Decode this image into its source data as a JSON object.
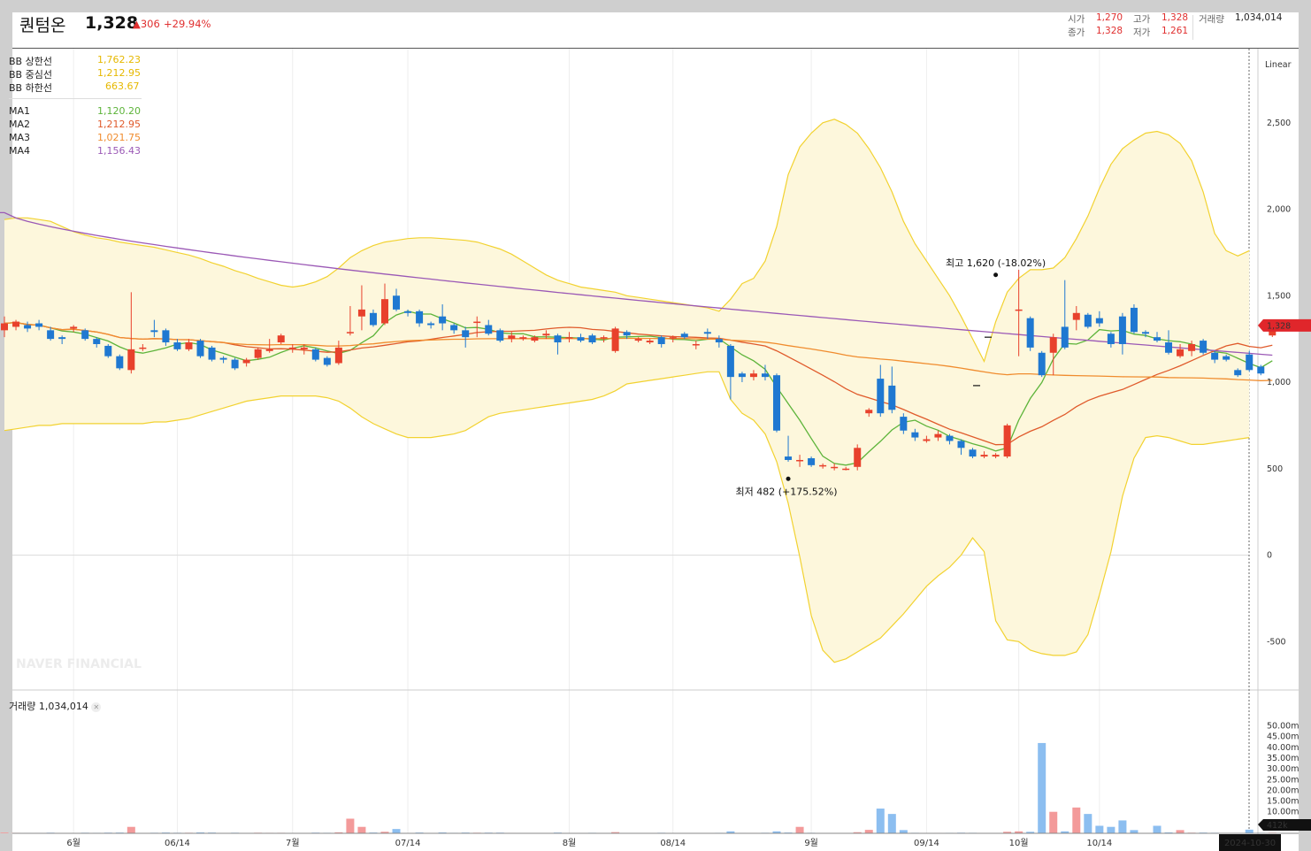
{
  "header": {
    "name": "퀀텀온",
    "price": "1,328",
    "change": "306",
    "change_rate": "+29.94%",
    "open_label": "시가",
    "open": "1,270",
    "high_label": "고가",
    "high": "1,328",
    "close_label": "종가",
    "close": "1,328",
    "low_label": "저가",
    "low": "1,261",
    "volume_label": "거래량",
    "volume": "1,034,014"
  },
  "legend": {
    "bb_upper_label": "BB 상한선",
    "bb_upper": "1,762.23",
    "bb_mid_label": "BB 중심선",
    "bb_mid": "1,212.95",
    "bb_lower_label": "BB 하한선",
    "bb_lower": "663.67",
    "ma1_label": "MA1",
    "ma1": "1,120.20",
    "ma2_label": "MA2",
    "ma2": "1,212.95",
    "ma3_label": "MA3",
    "ma3": "1,021.75",
    "ma4_label": "MA4",
    "ma4": "1,156.43"
  },
  "scale_label": "Linear",
  "annotations": {
    "high": "최고 1,620 (-18.02%)",
    "low": "최저 482 (+175.52%)"
  },
  "current_price_tag": "1,328",
  "volume_legend": "거래량 1,034,014",
  "volume_tag": "412k",
  "date_tag": "2024-10-30",
  "watermark": "NAVER FINANCIAL",
  "colors": {
    "up": "#e8412c",
    "down": "#1f78d1",
    "bb": "#f2d230",
    "bb_fill": "#fdf7dc",
    "ma1": "#5db43a",
    "ma2": "#e05a2b",
    "ma3": "#f08c2e",
    "ma4": "#9b59b6"
  },
  "chart_data": {
    "type": "candlestick",
    "price_axis": {
      "ticks": [
        2500,
        2000,
        1500,
        1000,
        500,
        0,
        -500
      ],
      "ylim": [
        -800,
        2760
      ]
    },
    "volume_axis": {
      "unit": "m",
      "ticks": [
        50,
        45,
        40,
        35,
        30,
        25,
        20,
        15,
        10
      ],
      "ylim": [
        0,
        54
      ]
    },
    "x_ticks": [
      {
        "label": "6월",
        "index": 6
      },
      {
        "label": "06/14",
        "index": 15
      },
      {
        "label": "7월",
        "index": 25
      },
      {
        "label": "07/14",
        "index": 35
      },
      {
        "label": "8월",
        "index": 49
      },
      {
        "label": "08/14",
        "index": 58
      },
      {
        "label": "9월",
        "index": 70
      },
      {
        "label": "09/14",
        "index": 80
      },
      {
        "label": "10월",
        "index": 88
      },
      {
        "label": "10/14",
        "index": 95
      }
    ],
    "ohlc": [
      [
        1300,
        1340,
        1260,
        1380
      ],
      [
        1320,
        1350,
        1300,
        1360
      ],
      [
        1330,
        1310,
        1290,
        1350
      ],
      [
        1340,
        1320,
        1300,
        1360
      ],
      [
        1300,
        1250,
        1240,
        1320
      ],
      [
        1260,
        1250,
        1220,
        1270
      ],
      [
        1310,
        1320,
        1290,
        1330
      ],
      [
        1300,
        1250,
        1240,
        1310
      ],
      [
        1250,
        1220,
        1200,
        1260
      ],
      [
        1210,
        1150,
        1140,
        1220
      ],
      [
        1150,
        1080,
        1070,
        1160
      ],
      [
        1070,
        1190,
        1050,
        1520
      ],
      [
        1200,
        1200,
        1180,
        1220
      ],
      [
        1300,
        1290,
        1260,
        1360
      ],
      [
        1300,
        1230,
        1210,
        1310
      ],
      [
        1230,
        1190,
        1180,
        1250
      ],
      [
        1190,
        1230,
        1180,
        1250
      ],
      [
        1240,
        1150,
        1140,
        1250
      ],
      [
        1200,
        1130,
        1120,
        1210
      ],
      [
        1140,
        1130,
        1110,
        1150
      ],
      [
        1130,
        1080,
        1070,
        1140
      ],
      [
        1110,
        1130,
        1090,
        1140
      ],
      [
        1140,
        1190,
        1130,
        1200
      ],
      [
        1180,
        1190,
        1170,
        1250
      ],
      [
        1230,
        1270,
        1220,
        1280
      ],
      [
        1200,
        1200,
        1170,
        1220
      ],
      [
        1190,
        1200,
        1160,
        1220
      ],
      [
        1190,
        1130,
        1120,
        1200
      ],
      [
        1140,
        1100,
        1090,
        1150
      ],
      [
        1110,
        1200,
        1100,
        1240
      ],
      [
        1290,
        1290,
        1270,
        1440
      ],
      [
        1380,
        1420,
        1300,
        1560
      ],
      [
        1400,
        1330,
        1320,
        1420
      ],
      [
        1340,
        1480,
        1330,
        1570
      ],
      [
        1500,
        1420,
        1410,
        1540
      ],
      [
        1410,
        1400,
        1380,
        1420
      ],
      [
        1410,
        1340,
        1320,
        1420
      ],
      [
        1340,
        1330,
        1310,
        1350
      ],
      [
        1380,
        1340,
        1300,
        1450
      ],
      [
        1330,
        1300,
        1280,
        1340
      ],
      [
        1300,
        1260,
        1200,
        1320
      ],
      [
        1350,
        1350,
        1260,
        1380
      ],
      [
        1330,
        1280,
        1270,
        1360
      ],
      [
        1300,
        1240,
        1230,
        1310
      ],
      [
        1250,
        1270,
        1230,
        1290
      ],
      [
        1250,
        1260,
        1240,
        1270
      ],
      [
        1240,
        1260,
        1230,
        1270
      ],
      [
        1270,
        1280,
        1250,
        1300
      ],
      [
        1270,
        1230,
        1160,
        1280
      ],
      [
        1260,
        1260,
        1230,
        1290
      ],
      [
        1260,
        1240,
        1230,
        1280
      ],
      [
        1270,
        1230,
        1220,
        1280
      ],
      [
        1260,
        1260,
        1230,
        1270
      ],
      [
        1180,
        1310,
        1170,
        1320
      ],
      [
        1290,
        1270,
        1250,
        1300
      ],
      [
        1240,
        1250,
        1230,
        1260
      ],
      [
        1230,
        1240,
        1220,
        1250
      ],
      [
        1260,
        1220,
        1200,
        1270
      ],
      [
        1260,
        1260,
        1230,
        1270
      ],
      [
        1280,
        1260,
        1250,
        1290
      ],
      [
        1220,
        1220,
        1190,
        1240
      ],
      [
        1290,
        1280,
        1250,
        1310
      ],
      [
        1250,
        1230,
        1200,
        1270
      ],
      [
        1210,
        1030,
        900,
        1220
      ],
      [
        1050,
        1030,
        1000,
        1060
      ],
      [
        1030,
        1050,
        1010,
        1070
      ],
      [
        1050,
        1030,
        1010,
        1100
      ],
      [
        1040,
        720,
        710,
        1050
      ],
      [
        570,
        550,
        540,
        690
      ],
      [
        550,
        550,
        510,
        580
      ],
      [
        560,
        520,
        510,
        570
      ],
      [
        520,
        520,
        500,
        530
      ],
      [
        510,
        510,
        490,
        530
      ],
      [
        500,
        500,
        490,
        510
      ],
      [
        510,
        620,
        490,
        640
      ],
      [
        820,
        840,
        800,
        850
      ],
      [
        1020,
        820,
        800,
        1100
      ],
      [
        980,
        840,
        820,
        1090
      ],
      [
        800,
        720,
        700,
        820
      ],
      [
        710,
        680,
        660,
        730
      ],
      [
        660,
        670,
        650,
        690
      ],
      [
        680,
        700,
        660,
        720
      ],
      [
        690,
        660,
        640,
        700
      ],
      [
        660,
        620,
        580,
        670
      ],
      [
        610,
        570,
        560,
        620
      ],
      [
        570,
        580,
        560,
        600
      ],
      [
        570,
        580,
        560,
        590
      ],
      [
        570,
        750,
        560,
        760
      ],
      [
        1420,
        1420,
        1150,
        1650
      ],
      [
        1370,
        1200,
        1180,
        1380
      ],
      [
        1170,
        1040,
        1030,
        1180
      ],
      [
        1170,
        1260,
        1040,
        1280
      ],
      [
        1320,
        1200,
        1190,
        1590
      ],
      [
        1360,
        1400,
        1300,
        1440
      ],
      [
        1390,
        1320,
        1310,
        1400
      ],
      [
        1370,
        1340,
        1320,
        1410
      ],
      [
        1280,
        1220,
        1200,
        1290
      ],
      [
        1380,
        1220,
        1160,
        1400
      ],
      [
        1430,
        1290,
        1280,
        1450
      ],
      [
        1290,
        1280,
        1260,
        1300
      ],
      [
        1260,
        1240,
        1230,
        1290
      ],
      [
        1230,
        1170,
        1160,
        1300
      ],
      [
        1150,
        1190,
        1140,
        1220
      ],
      [
        1180,
        1220,
        1150,
        1240
      ],
      [
        1240,
        1170,
        1160,
        1250
      ],
      [
        1170,
        1130,
        1110,
        1180
      ],
      [
        1150,
        1130,
        1120,
        1160
      ],
      [
        1070,
        1040,
        1030,
        1080
      ],
      [
        1160,
        1070,
        1060,
        1180
      ],
      [
        1090,
        1050,
        1040,
        1100
      ],
      [
        1270,
        1328,
        1261,
        1328
      ]
    ],
    "bb_upper": [
      1940,
      1950,
      1950,
      1940,
      1930,
      1900,
      1870,
      1850,
      1835,
      1825,
      1810,
      1800,
      1790,
      1780,
      1765,
      1750,
      1735,
      1715,
      1690,
      1670,
      1645,
      1625,
      1600,
      1580,
      1560,
      1550,
      1560,
      1580,
      1610,
      1660,
      1720,
      1760,
      1790,
      1810,
      1820,
      1830,
      1835,
      1835,
      1830,
      1825,
      1820,
      1810,
      1790,
      1770,
      1740,
      1700,
      1660,
      1620,
      1590,
      1570,
      1550,
      1540,
      1530,
      1520,
      1500,
      1490,
      1480,
      1470,
      1460,
      1450,
      1440,
      1430,
      1410,
      1480,
      1570,
      1600,
      1700,
      1900,
      2200,
      2360,
      2440,
      2500,
      2520,
      2490,
      2440,
      2350,
      2240,
      2100,
      1930,
      1800,
      1700,
      1600,
      1500,
      1380,
      1250,
      1120,
      1350,
      1520,
      1600,
      1650,
      1650,
      1660,
      1720,
      1830,
      1960,
      2120,
      2260,
      2350,
      2400,
      2440,
      2450,
      2430,
      2380,
      2280,
      2100,
      1860,
      1760,
      1730,
      1760
    ],
    "bb_lower": [
      720,
      730,
      740,
      750,
      750,
      760,
      760,
      760,
      760,
      760,
      760,
      760,
      760,
      770,
      770,
      780,
      790,
      810,
      830,
      850,
      870,
      890,
      900,
      910,
      920,
      920,
      920,
      920,
      910,
      890,
      850,
      800,
      760,
      730,
      700,
      680,
      680,
      680,
      690,
      700,
      720,
      760,
      800,
      820,
      830,
      840,
      850,
      860,
      870,
      880,
      890,
      900,
      920,
      950,
      990,
      1000,
      1010,
      1020,
      1030,
      1040,
      1050,
      1060,
      1060,
      900,
      820,
      780,
      700,
      540,
      300,
      -10,
      -350,
      -550,
      -620,
      -600,
      -560,
      -520,
      -480,
      -410,
      -340,
      -260,
      -180,
      -120,
      -70,
      0,
      100,
      20,
      -380,
      -490,
      -500,
      -550,
      -570,
      -580,
      -580,
      -560,
      -460,
      -230,
      20,
      340,
      560,
      680,
      690,
      680,
      660,
      640,
      640,
      650,
      660,
      670,
      680
    ]
  }
}
